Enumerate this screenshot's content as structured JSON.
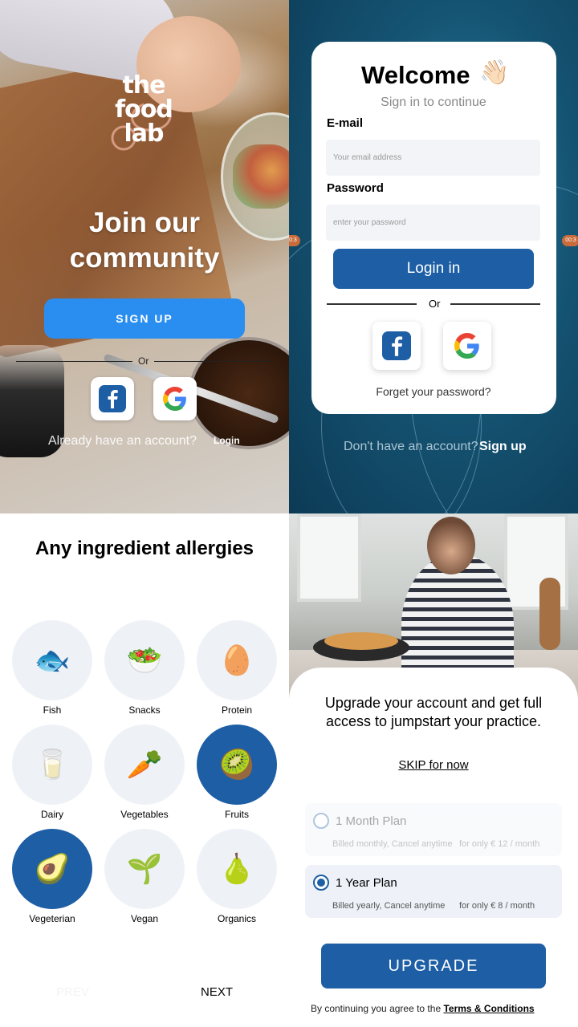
{
  "screen1": {
    "logo_line1": "the",
    "logo_line2": "food",
    "logo_line3": "lab",
    "heading_line1": "Join our",
    "heading_line2": "community",
    "signup_label": "SIGN UP",
    "or_label": "Or",
    "facebook_icon": "facebook-icon",
    "google_icon": "google-icon",
    "already_text": "Already have an account?",
    "login_link": "Login"
  },
  "screen2": {
    "title": "Welcome",
    "title_emoji": "👋🏻",
    "subtitle": "Sign in to continue",
    "email_label": "E-mail",
    "email_placeholder": "Your email address",
    "password_label": "Password",
    "password_placeholder": "enter your password",
    "login_label": "Login in",
    "or_label": "Or",
    "forgot_text": "Forget your password?",
    "no_account_text": "Don't have an account?",
    "signup_link": "Sign up",
    "timer_text": "00:3"
  },
  "screen3": {
    "title": "Any ingredient allergies",
    "items": [
      {
        "label": "Fish",
        "emoji": "🐟",
        "selected": false
      },
      {
        "label": "Snacks",
        "emoji": "🥗",
        "selected": false
      },
      {
        "label": "Protein",
        "emoji": "🥚",
        "selected": false
      },
      {
        "label": "Dairy",
        "emoji": "🥛",
        "selected": false
      },
      {
        "label": "Vegetables",
        "emoji": "🥕",
        "selected": false
      },
      {
        "label": "Fruits",
        "emoji": "🥝",
        "selected": true
      },
      {
        "label": "Vegeterian",
        "emoji": "🥑",
        "selected": true
      },
      {
        "label": "Vegan",
        "emoji": "🌱",
        "selected": false
      },
      {
        "label": "Organics",
        "emoji": "🍐",
        "selected": false
      }
    ],
    "prev_label": "PREV",
    "next_label": "NEXT"
  },
  "screen4": {
    "heading_line1": "Upgrade your account and get full",
    "heading_line2": "access to jumpstart your practice.",
    "skip_label": "SKIP for now",
    "plans": [
      {
        "name": "1 Month Plan",
        "billing": "Billed monthly, Cancel anytime",
        "price": "for only € 12 / month",
        "selected": false
      },
      {
        "name": "1 Year Plan",
        "billing": "Billed yearly, Cancel anytime",
        "price": "for only € 8 / month",
        "selected": true
      }
    ],
    "upgrade_label": "UPGRADE",
    "terms_prefix": "By continuing you agree to the",
    "terms_link": "Terms & Conditions"
  },
  "colors": {
    "primary_blue": "#1d5ea5",
    "signup_blue": "#2a8ef0",
    "selected_circle": "#1d5ea5",
    "circle_bg": "#eef2f7"
  }
}
